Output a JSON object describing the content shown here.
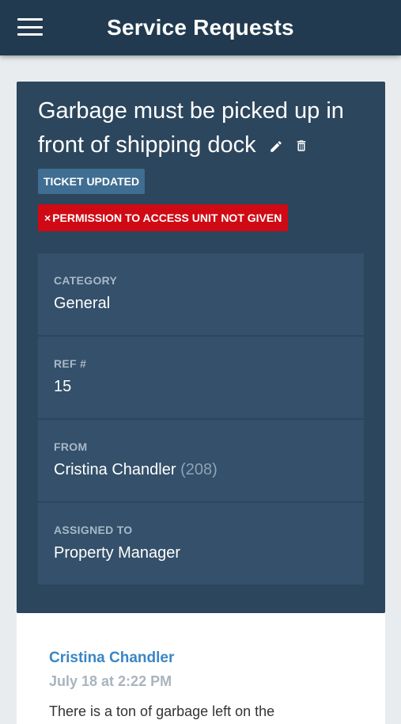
{
  "header": {
    "title": "Service Requests",
    "menu_icon": "hamburger-menu-icon"
  },
  "ticket": {
    "title": "Garbage must be picked up in front of shipping dock",
    "edit_icon": "pencil-icon",
    "delete_icon": "trash-icon",
    "badges": {
      "updated": "TICKET UPDATED",
      "permission_mark": "×",
      "permission": "PERMISSION TO ACCESS UNIT NOT GIVEN"
    },
    "details": [
      {
        "label": "CATEGORY",
        "value": "General"
      },
      {
        "label": "REF #",
        "value": "15"
      },
      {
        "label": "FROM",
        "value": "Cristina Chandler",
        "extra": "(208)"
      },
      {
        "label": "ASSIGNED TO",
        "value": "Property Manager"
      }
    ]
  },
  "comment": {
    "author": "Cristina Chandler",
    "time": "July 18 at 2:22 PM",
    "text": "There is a ton of garbage left on the"
  },
  "colors": {
    "appbar": "#213a4f",
    "card": "#2c465d",
    "detail_bg": "#34506a",
    "badge_updated": "#3f6e92",
    "badge_permission": "#cf0a14",
    "link": "#3a86c5"
  }
}
